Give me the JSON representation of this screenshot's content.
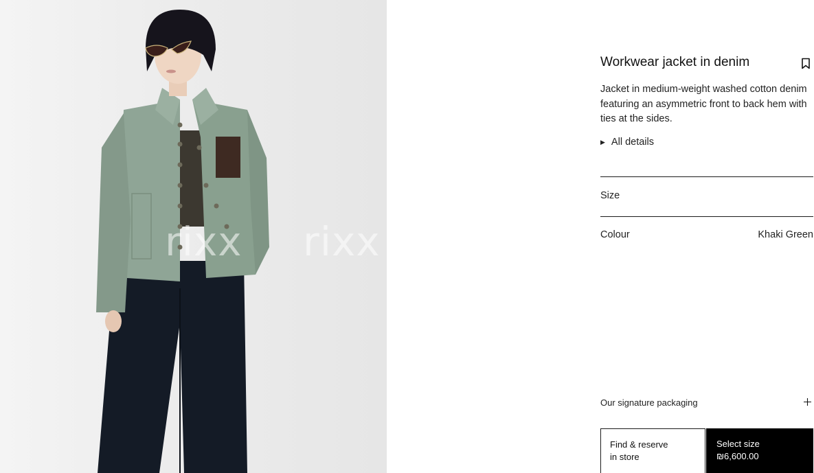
{
  "image": {
    "watermark": "rixx"
  },
  "product": {
    "title": "Workwear jacket in denim",
    "description": "Jacket in medium-weight washed cotton denim featuring an asymmetric front to back hem with ties at the sides.",
    "all_details_label": "All details"
  },
  "size": {
    "label": "Size"
  },
  "colour": {
    "label": "Colour",
    "value": "Khaki Green"
  },
  "packaging": {
    "label": "Our signature packaging"
  },
  "actions": {
    "find_store_line1": "Find & reserve",
    "find_store_line2": "in store",
    "select_size_label": "Select size",
    "price": "₪6,600.00"
  },
  "icons": {
    "bookmark": "bookmark-icon",
    "expand": "plus-icon",
    "disclosure": "triangle-right-icon"
  },
  "colors": {
    "primary_button_bg": "#000000",
    "text": "#1a1a1a",
    "image_bg": "#ececec"
  }
}
